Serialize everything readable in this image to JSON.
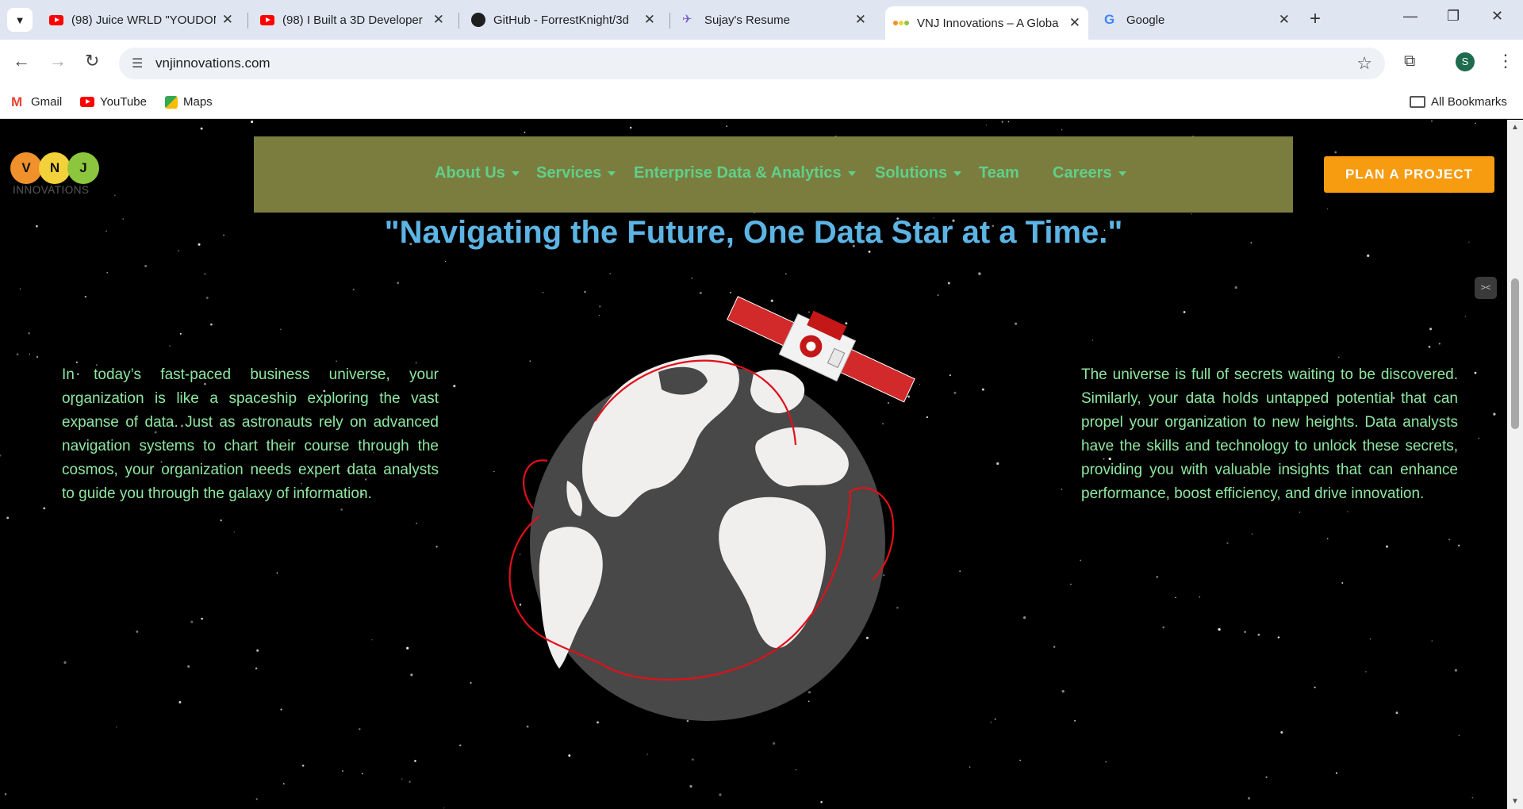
{
  "browser": {
    "tabs": [
      {
        "title": "(98) Juice WRLD \"YOUDON",
        "icon": "youtube-icon"
      },
      {
        "title": "(98) I Built a 3D Developer",
        "icon": "youtube-icon"
      },
      {
        "title": "GitHub - ForrestKnight/3d",
        "icon": "github-icon"
      },
      {
        "title": "Sujay's Resume",
        "icon": "resume-icon"
      },
      {
        "title": "VNJ Innovations – A Globa",
        "icon": "vnj-icon",
        "active": true
      },
      {
        "title": "Google",
        "icon": "google-icon"
      }
    ],
    "url": "vnjinnovations.com",
    "profile_initial": "S",
    "bookmarks": [
      {
        "label": "Gmail",
        "icon": "gmail-icon"
      },
      {
        "label": "YouTube",
        "icon": "youtube-icon"
      },
      {
        "label": "Maps",
        "icon": "maps-icon"
      }
    ],
    "all_bookmarks": "All Bookmarks"
  },
  "site": {
    "logo": {
      "letters": [
        "V",
        "N",
        "J"
      ],
      "subtitle": "INNOVATIONS",
      "colors": [
        "#f0912b",
        "#f3d13a",
        "#8cc63f"
      ]
    },
    "nav": [
      {
        "label": "About Us",
        "dropdown": true
      },
      {
        "label": "Services",
        "dropdown": true
      },
      {
        "label": "Enterprise Data & Analytics",
        "dropdown": true
      },
      {
        "label": "Solutions",
        "dropdown": true
      },
      {
        "label": "Team",
        "dropdown": false
      },
      {
        "label": "Careers",
        "dropdown": true
      }
    ],
    "cta": "PLAN A PROJECT",
    "headline": "\"Navigating the Future, One Data Star at a Time.\"",
    "left_text": "In today’s fast-paced business universe, your organization is like a spaceship exploring the vast expanse of data. Just as astronauts rely on advanced navigation systems to chart their course through the cosmos, your organization needs expert data analysts to guide you through the galaxy of information.",
    "right_text": "The universe is full of secrets waiting to be discovered. Similarly, your data holds untapped potential that can propel your organization to new heights. Data analysts have the skills and technology to unlock these secrets, providing you with valuable insights that can enhance performance, boost efficiency, and drive innovation.",
    "side_widget": "><",
    "colors": {
      "navbar": "#7b7d3e",
      "nav_text": "#5fcf8a",
      "cta": "#f79b10",
      "headline": "#5cb4e4",
      "body_text": "#8ee6a0",
      "orbit": "#e0101a"
    }
  }
}
